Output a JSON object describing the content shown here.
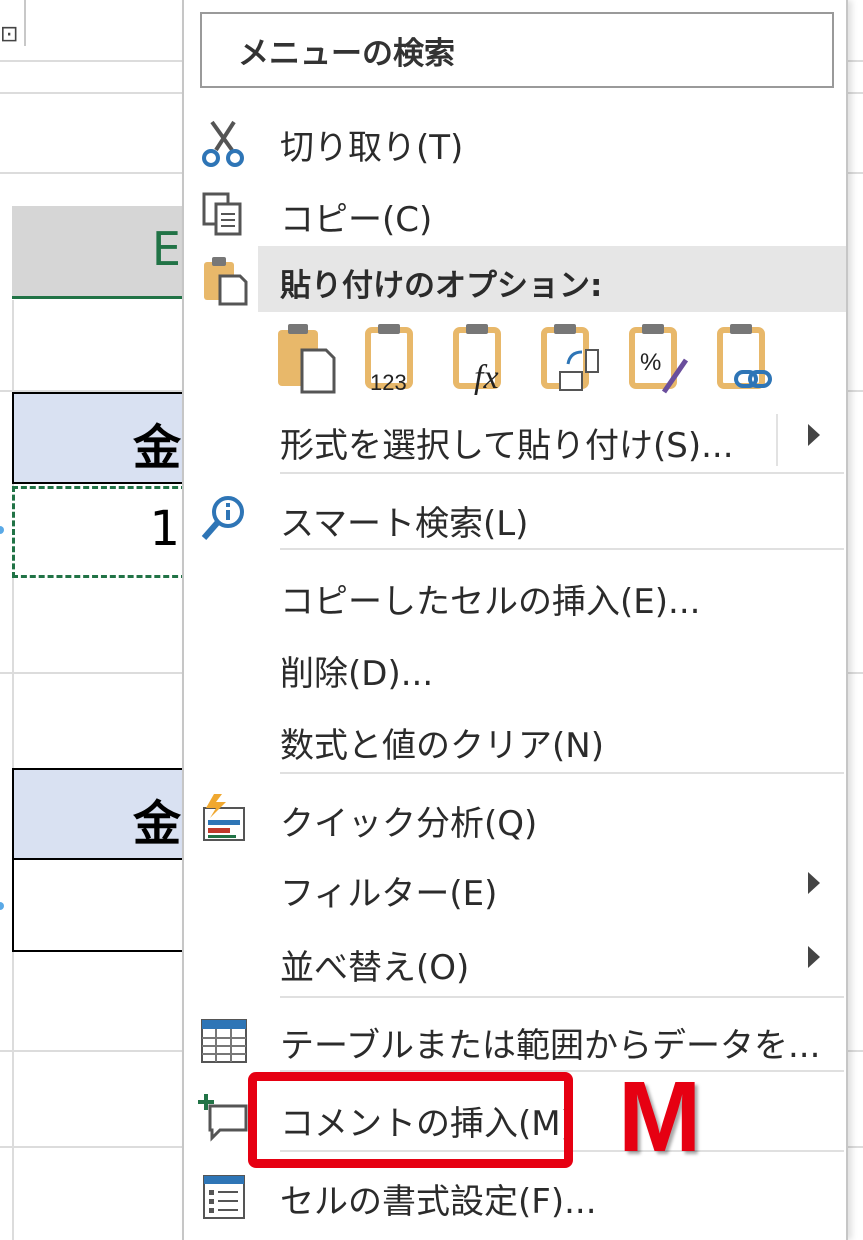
{
  "sheet": {
    "column_header": "E",
    "header_cell_1": "金",
    "header_cell_2": "金",
    "value_cell": "1"
  },
  "menu": {
    "search_placeholder": "メニューの検索",
    "cut_label": "切り取り(T)",
    "copy_label": "コピー(C)",
    "paste_options_label": "貼り付けのオプション:",
    "paste_values_text": "123",
    "paste_formula_text": "fx",
    "paste_format_text": "%",
    "paste_special_label": "形式を選択して貼り付け(S)...",
    "smart_lookup_label": "スマート検索(L)",
    "insert_copied_label": "コピーしたセルの挿入(E)...",
    "delete_label": "削除(D)...",
    "clear_label": "数式と値のクリア(N)",
    "quick_analysis_label": "クイック分析(Q)",
    "filter_label": "フィルター(E)",
    "sort_label": "並べ替え(O)",
    "table_label": "テーブルまたは範囲からデータを...",
    "insert_comment_label": "コメントの挿入(M)",
    "format_cells_label": "セルの書式設定(F)..."
  },
  "annotation": {
    "key_label": "M",
    "color": "#e60012"
  },
  "colors": {
    "excel_green": "#217346",
    "header_fill": "#d9e1f2",
    "clipboard": "#e8b86a"
  }
}
